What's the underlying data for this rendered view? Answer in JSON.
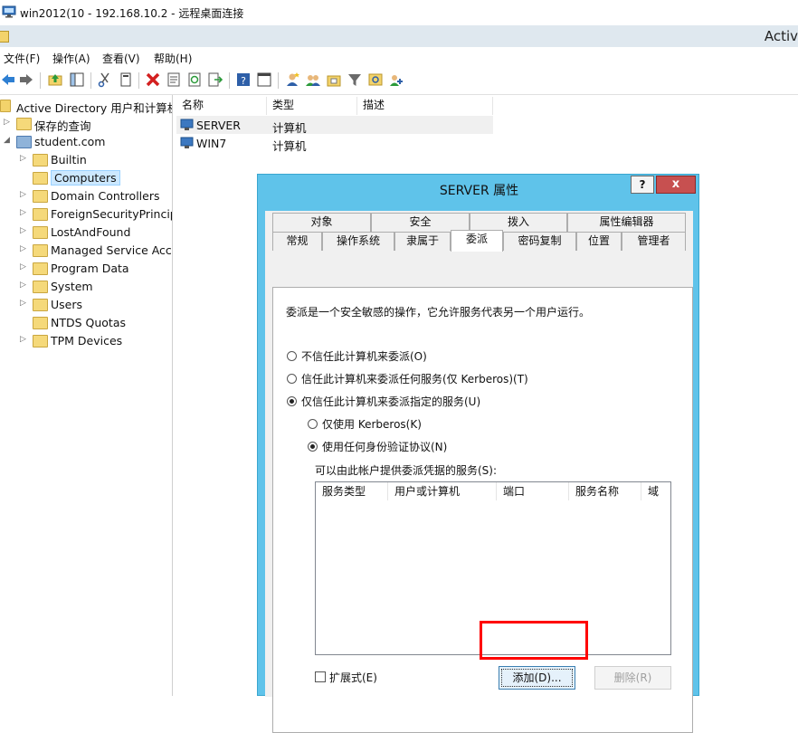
{
  "rdp": {
    "title": "win2012(10 - 192.168.10.2 - 远程桌面连接"
  },
  "mmc": {
    "caption": "Activ"
  },
  "menu": {
    "items": [
      "文件(F)",
      "操作(A)",
      "查看(V)",
      "帮助(H)"
    ]
  },
  "toolbar": {
    "icons": [
      "back-icon",
      "forward-icon",
      "up-folder-icon",
      "show-hide-tree-icon",
      "cut-icon",
      "copy-icon",
      "delete-icon",
      "properties-icon",
      "refresh-icon",
      "export-icon",
      "help-icon",
      "view-icon",
      "new-user-icon",
      "new-group-icon",
      "new-ou-icon",
      "filter-icon",
      "find-icon",
      "add-to-group-icon"
    ]
  },
  "tree": {
    "root": "Active Directory 用户和计算机",
    "items": [
      {
        "label": "保存的查询",
        "level": 1,
        "expander": "▷"
      },
      {
        "label": "student.com",
        "level": 1,
        "expander": "◢"
      },
      {
        "label": "Builtin",
        "level": 2,
        "expander": "▷"
      },
      {
        "label": "Computers",
        "level": 2,
        "expander": "",
        "selected": true
      },
      {
        "label": "Domain Controllers",
        "level": 2,
        "expander": "▷"
      },
      {
        "label": "ForeignSecurityPrincipals",
        "level": 2,
        "expander": "▷"
      },
      {
        "label": "LostAndFound",
        "level": 2,
        "expander": "▷"
      },
      {
        "label": "Managed Service Accounts",
        "level": 2,
        "expander": "▷"
      },
      {
        "label": "Program Data",
        "level": 2,
        "expander": "▷"
      },
      {
        "label": "System",
        "level": 2,
        "expander": "▷"
      },
      {
        "label": "Users",
        "level": 2,
        "expander": "▷"
      },
      {
        "label": "NTDS Quotas",
        "level": 2,
        "expander": ""
      },
      {
        "label": "TPM Devices",
        "level": 2,
        "expander": "▷"
      }
    ]
  },
  "list": {
    "columns": [
      "名称",
      "类型",
      "描述"
    ],
    "rows": [
      {
        "name": "SERVER",
        "type": "计算机",
        "desc": ""
      },
      {
        "name": "WIN7",
        "type": "计算机",
        "desc": ""
      }
    ]
  },
  "dialog": {
    "title": "SERVER 属性",
    "help": "?",
    "close": "x",
    "tabs_top": [
      "对象",
      "安全",
      "拨入",
      "属性编辑器"
    ],
    "tabs_bottom": [
      "常规",
      "操作系统",
      "隶属于",
      "委派",
      "密码复制",
      "位置",
      "管理者"
    ],
    "active_tab": "委派",
    "description": "委派是一个安全敏感的操作，它允许服务代表另一个用户运行。",
    "options": [
      {
        "label": "不信任此计算机来委派(O)",
        "selected": false
      },
      {
        "label": "信任此计算机来委派任何服务(仅 Kerberos)(T)",
        "selected": false
      },
      {
        "label": "仅信任此计算机来委派指定的服务(U)",
        "selected": true
      }
    ],
    "sub_options": [
      {
        "label": "仅使用 Kerberos(K)",
        "selected": false
      },
      {
        "label": "使用任何身份验证协议(N)",
        "selected": true
      }
    ],
    "services_label": "可以由此帐户提供委派凭据的服务(S):",
    "service_columns": [
      "服务类型",
      "用户或计算机",
      "端口",
      "服务名称",
      "域"
    ],
    "expanded_label": "扩展式(E)",
    "expanded_checked": false,
    "add_button": "添加(D)...",
    "remove_button": "删除(R)"
  }
}
